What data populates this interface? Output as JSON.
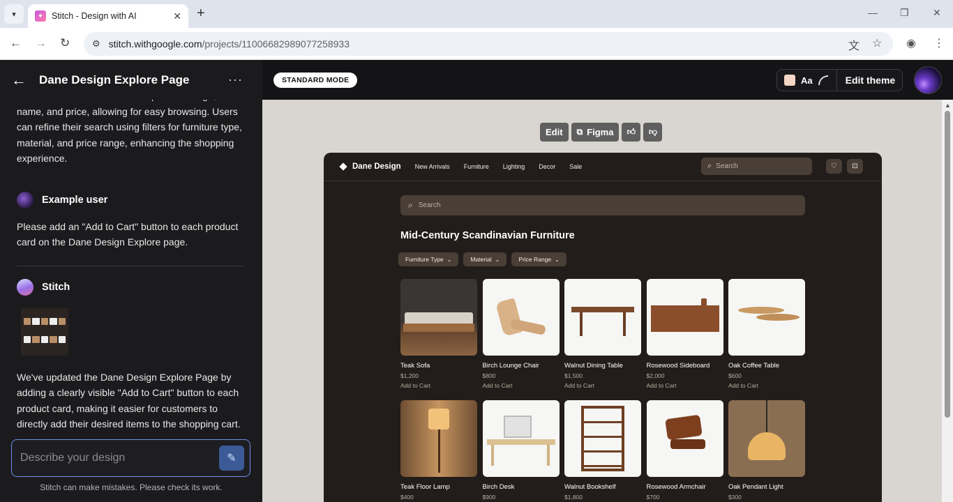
{
  "browser": {
    "tab_title": "Stitch - Design with AI",
    "url_domain": "stitch.withgoogle.com",
    "url_path": "/projects/11006682989077258933"
  },
  "left_panel": {
    "title": "Dane Design Explore Page",
    "intro_text": "item is showcased with a clear product image, its name, and price, allowing for easy browsing. Users can refine their search using filters for furniture type, material, and price range, enhancing the shopping experience.",
    "user_name": "Example user",
    "user_message": "Please add an \"Add to Cart\" button to each product card on the Dane Design Explore page.",
    "bot_name": "Stitch",
    "bot_message": "We've updated the Dane Design Explore Page by adding a clearly visible \"Add to Cart\" button to each product card, making it easier for customers to directly add their desired items to the shopping cart.",
    "prompt_placeholder": "Describe your design",
    "disclaimer": "Stitch can make mistakes. Please check its work."
  },
  "top_bar": {
    "mode_label": "STANDARD MODE",
    "font_label": "Aa",
    "edit_theme_label": "Edit theme",
    "accent_swatch": "#f3d6c4"
  },
  "canvas_toolbar": {
    "edit_label": "Edit",
    "figma_label": "Figma",
    "like_icon": "thumbs-up-icon",
    "dislike_icon": "thumbs-down-icon"
  },
  "site": {
    "brand": "Dane Design",
    "nav_links": [
      "New Arrivals",
      "Furniture",
      "Lighting",
      "Decor",
      "Sale"
    ],
    "nav_search_placeholder": "Search",
    "main_search_placeholder": "Search",
    "heading": "Mid-Century Scandinavian Furniture",
    "filters": [
      "Furniture Type",
      "Material",
      "Price Range"
    ],
    "cart_label": "Add to Cart",
    "products": [
      {
        "name": "Teak Sofa",
        "price": "$1,200"
      },
      {
        "name": "Birch Lounge Chair",
        "price": "$800"
      },
      {
        "name": "Walnut Dining Table",
        "price": "$1,500"
      },
      {
        "name": "Rosewood Sideboard",
        "price": "$2,000"
      },
      {
        "name": "Oak Coffee Table",
        "price": "$600"
      },
      {
        "name": "Teak Floor Lamp",
        "price": "$400"
      },
      {
        "name": "Birch Desk",
        "price": "$900"
      },
      {
        "name": "Walnut Bookshelf",
        "price": "$1,800"
      },
      {
        "name": "Rosewood Armchair",
        "price": "$700"
      },
      {
        "name": "Oak Pendant Light",
        "price": "$300"
      }
    ],
    "colors": {
      "background": "#221d1a",
      "surface": "#4a3f36",
      "muted_text": "#b7aca1"
    }
  }
}
